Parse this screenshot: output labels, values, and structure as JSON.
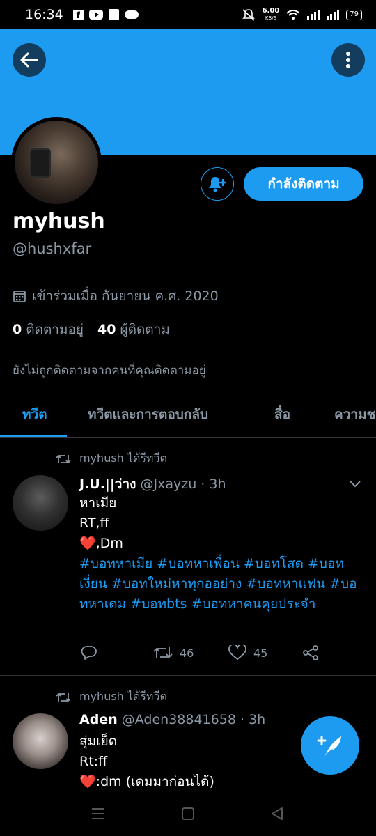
{
  "status_bar": {
    "time": "16:34",
    "net_speed": "6.00",
    "net_unit": "KB/S",
    "battery": "79"
  },
  "profile": {
    "display_name": "myhush",
    "handle": "@hushxfar",
    "joined": "เข้าร่วมเมื่อ กันยายน ค.ศ. 2020",
    "following_count": "0",
    "following_label": "ติดตามอยู่",
    "followers_count": "40",
    "followers_label": "ผู้ติดตาม",
    "not_followed_note": "ยังไม่ถูกติดตามจากคนที่คุณติดตามอยู่",
    "follow_button_label": "กำลังติดตาม"
  },
  "colors": {
    "accent": "#1d9bf0",
    "banner": "#1d9bf0",
    "heart": "#f91880",
    "muted": "#8b98a5"
  },
  "tabs": [
    {
      "label": "ทวีต",
      "active": true
    },
    {
      "label": "ทวีตและการตอบกลับ",
      "active": false
    },
    {
      "label": "สื่อ",
      "active": false
    },
    {
      "label": "ความช",
      "active": false
    }
  ],
  "tweets": [
    {
      "retweet_label": "myhush ได้รีทวีต",
      "author_name": "J.U.||ว่าง",
      "author_handle": "@Jxayzu",
      "time": "· 3h",
      "lines": [
        "หาเมีย",
        "RT,ff"
      ],
      "heart_line": ",Dm",
      "hashtags": "#บอทหาเมีย #บอทหาเพื่อน #บอทโสด #บอทเงี่ยน #บอทใหม่หาทุกออย่าง #บอทหาแฟน #บอทหาเดม #บอทbts #บอทหาคนคุยประจำ",
      "retweets": "46",
      "likes": "45"
    },
    {
      "retweet_label": "myhush ได้รีทวีต",
      "author_name": "Aden",
      "author_handle": "@Aden38841658",
      "time": "· 3h",
      "lines": [
        "สุ่มเย็ด",
        "Rt:ff"
      ],
      "heart_line": ":dm (เดมมาก่อนได้)"
    }
  ],
  "icons": {
    "back": "arrow-left-icon",
    "more": "more-vertical-icon",
    "notify": "bell-plus-icon",
    "calendar": "calendar-icon",
    "retweet": "retweet-icon",
    "reply": "reply-icon",
    "like": "heart-icon",
    "share": "share-icon",
    "compose": "compose-tweet-icon"
  }
}
